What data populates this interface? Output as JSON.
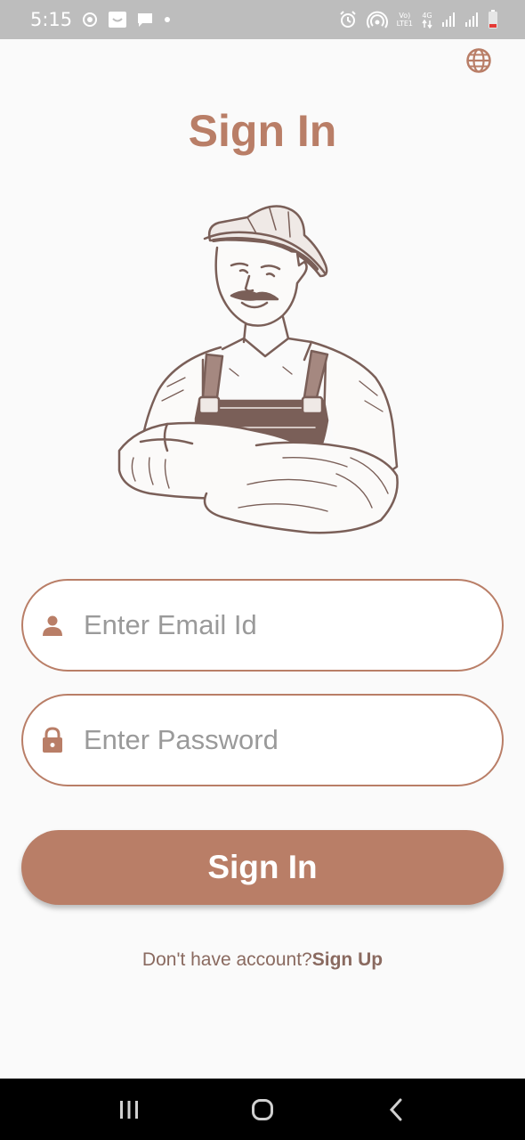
{
  "status_bar": {
    "time": "5:15",
    "network_top": "Vo)",
    "network_bottom": "LTE1",
    "network_gen": "4G",
    "icons": [
      "sync-icon",
      "smile-app-icon",
      "message-icon",
      "dot-icon",
      "alarm-icon",
      "hotspot-icon",
      "signal-icon",
      "battery-icon"
    ]
  },
  "header": {
    "language_icon": "globe-icon",
    "title": "Sign In"
  },
  "illustration": {
    "icon": "farmer-illustration"
  },
  "form": {
    "email": {
      "placeholder": "Enter Email Id",
      "value": "",
      "icon": "person-icon"
    },
    "password": {
      "placeholder": "Enter Password",
      "value": "",
      "icon": "lock-icon"
    },
    "submit_label": "Sign In"
  },
  "footer": {
    "prompt": "Don't have account?",
    "signup_label": "Sign Up"
  },
  "nav_bar": {
    "icons": [
      "recents-icon",
      "home-icon",
      "back-icon"
    ]
  },
  "colors": {
    "accent": "#b97e67",
    "background": "#fafafa",
    "status_bar": "#bdbdbd",
    "nav_bar": "#000000",
    "sketch": "#7a5f58"
  }
}
